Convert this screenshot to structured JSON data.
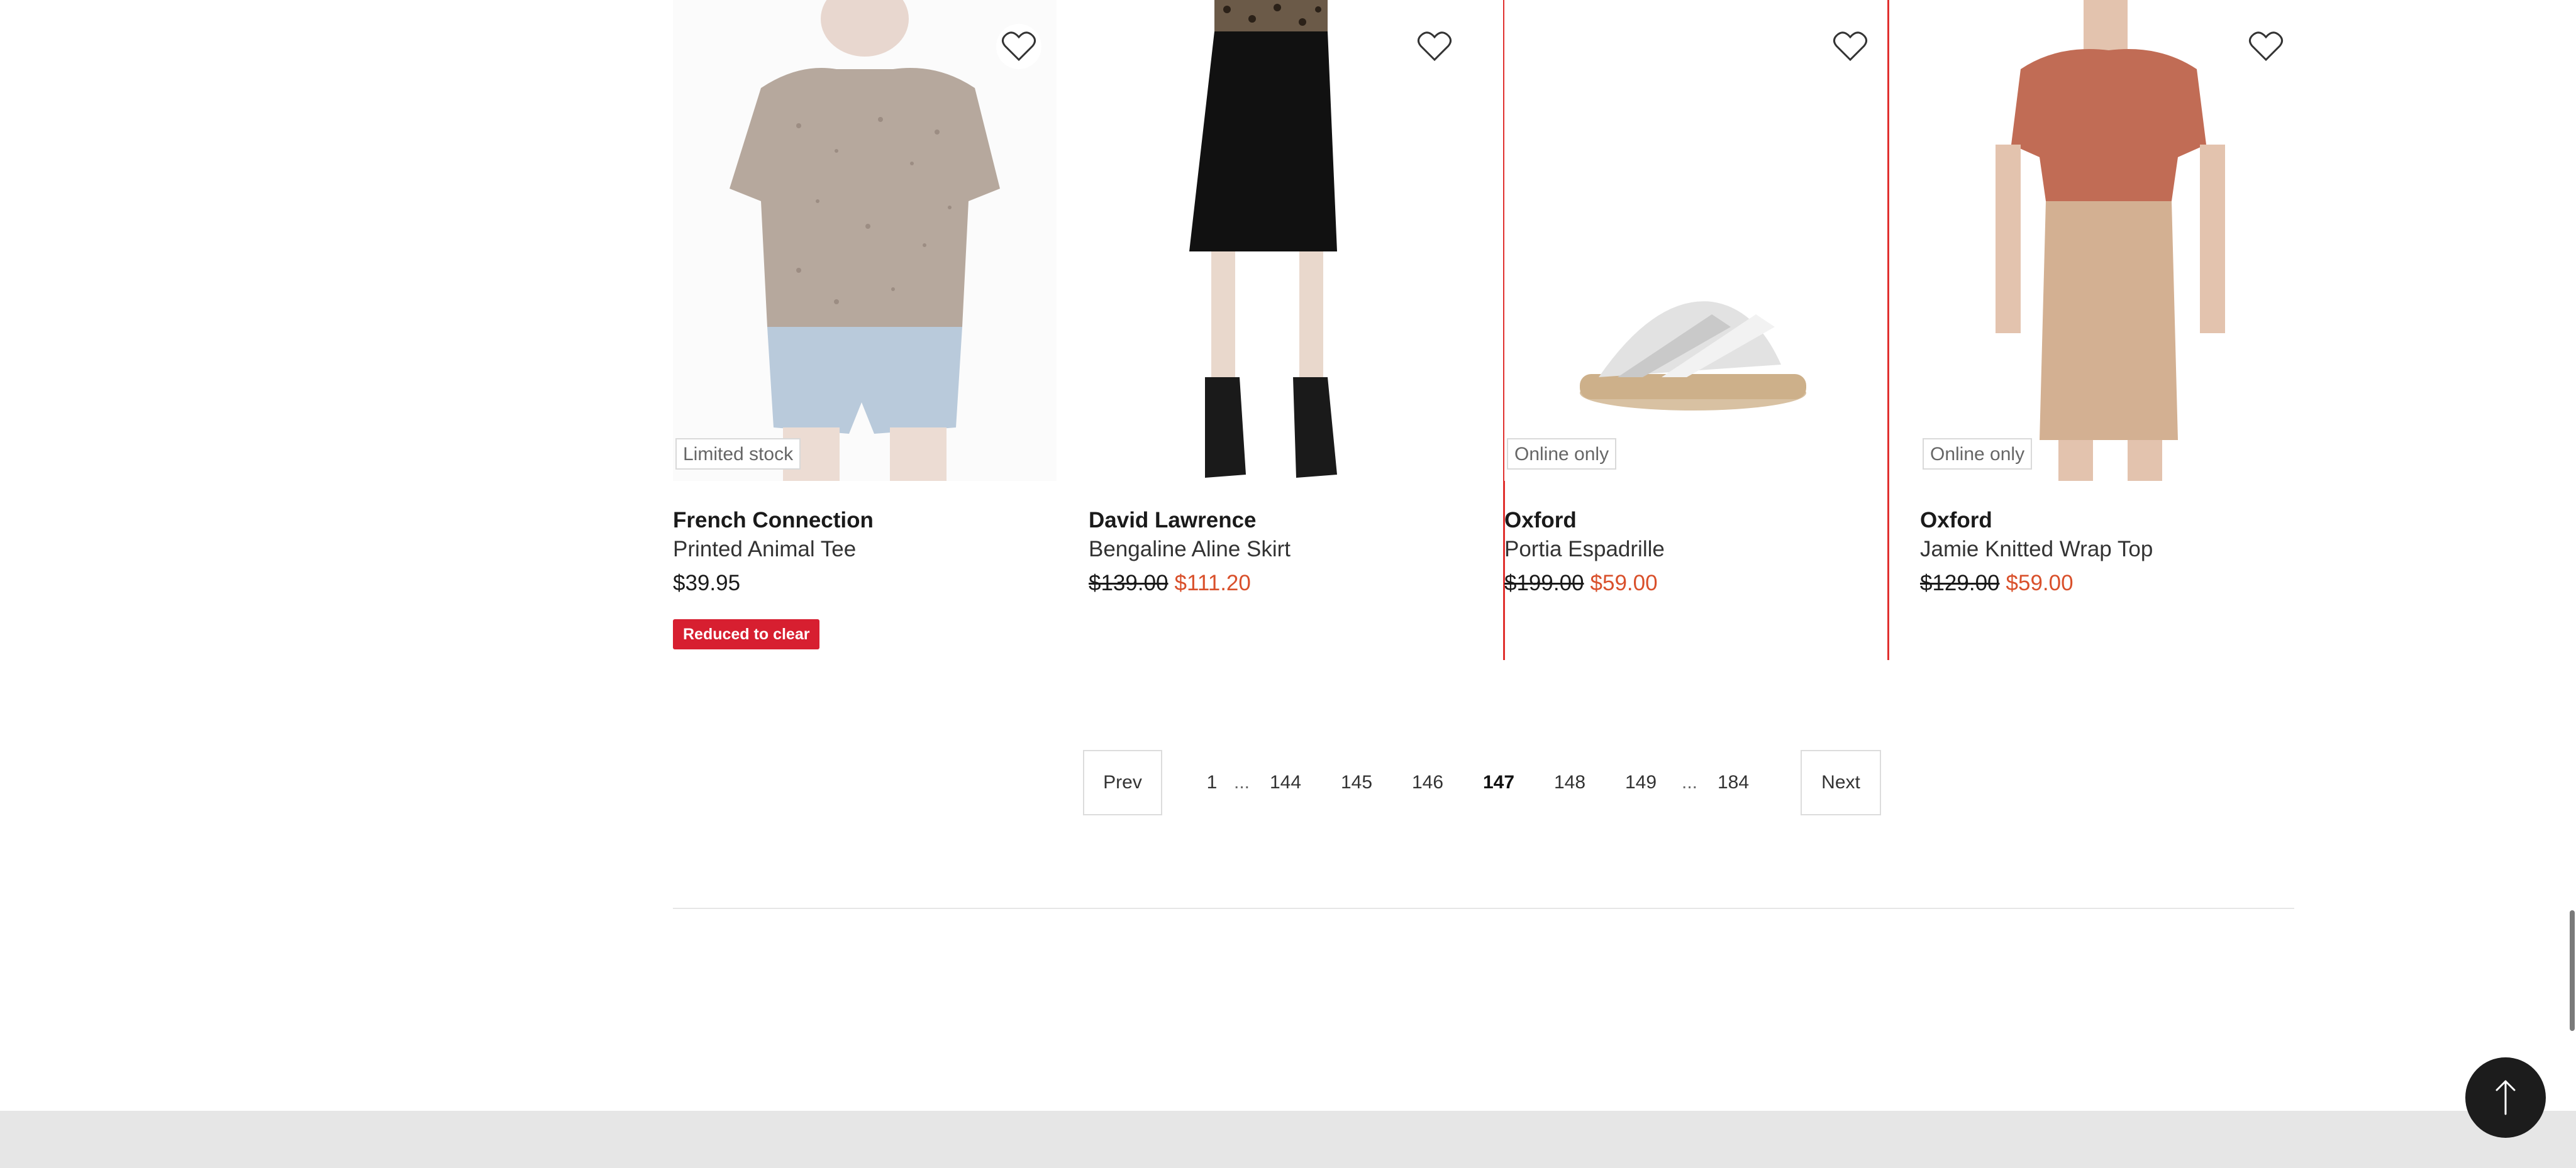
{
  "products": [
    {
      "badge": "Limited stock",
      "brand": "French Connection",
      "name": "Printed Animal Tee",
      "price": "$39.95",
      "promo": "Reduced to clear",
      "image_icon": "tshirt-model-image"
    },
    {
      "badge": "",
      "brand": "David Lawrence",
      "name": "Bengaline Aline Skirt",
      "price_was": "$139.00",
      "price_now": "$111.20",
      "image_icon": "skirt-model-image"
    },
    {
      "badge": "Online only",
      "brand": "Oxford",
      "name": "Portia Espadrille",
      "price_was": "$199.00",
      "price_now": "$59.00",
      "image_icon": "sandal-image"
    },
    {
      "badge": "Online only",
      "brand": "Oxford",
      "name": "Jamie Knitted Wrap Top",
      "price_was": "$129.00",
      "price_now": "$59.00",
      "image_icon": "wrap-top-model-image"
    }
  ],
  "pagination": {
    "prev": "Prev",
    "next": "Next",
    "pages": [
      "1",
      "144",
      "145",
      "146",
      "147",
      "148",
      "149",
      "184"
    ],
    "current": "147",
    "ellipsis": "..."
  },
  "colors": {
    "sale_price": "#d9502b",
    "promo_badge": "#d71f30",
    "selected_outline": "#e0302e",
    "back_to_top": "#1c1c1c"
  },
  "back_to_top_icon": "arrow-up-icon"
}
